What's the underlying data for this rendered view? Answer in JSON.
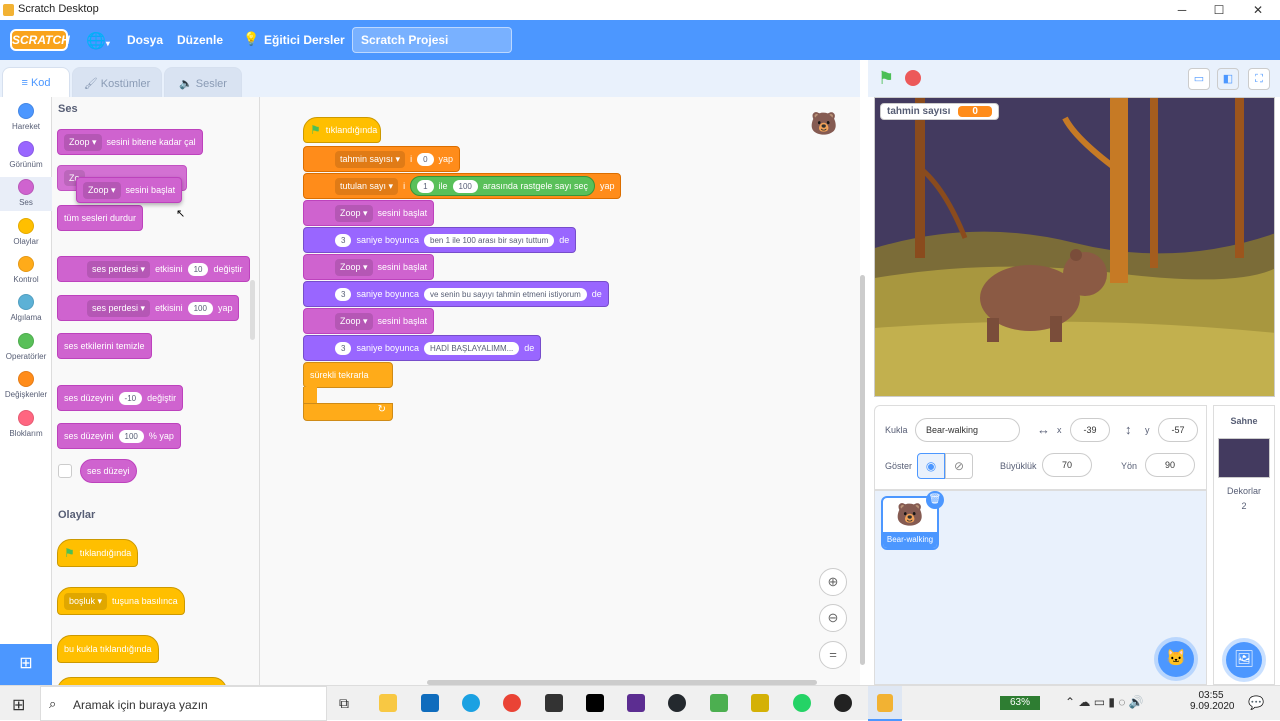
{
  "window": {
    "title": "Scratch Desktop",
    "controls": [
      "─",
      "☐",
      "✕"
    ]
  },
  "menubar": {
    "logo": "SCRATCH",
    "file": "Dosya",
    "edit": "Düzenle",
    "tutorials": "Eğitici Dersler",
    "project_title": "Scratch Projesi"
  },
  "tabs": {
    "code": "Kod",
    "costumes": "Kostümler",
    "sounds": "Sesler"
  },
  "categories": [
    {
      "label": "Hareket",
      "color": "#4c97ff"
    },
    {
      "label": "Görünüm",
      "color": "#9966ff"
    },
    {
      "label": "Ses",
      "color": "#cf63cf"
    },
    {
      "label": "Olaylar",
      "color": "#ffbf00"
    },
    {
      "label": "Kontrol",
      "color": "#ffab19"
    },
    {
      "label": "Algılama",
      "color": "#5cb1d6"
    },
    {
      "label": "Operatörler",
      "color": "#59c059"
    },
    {
      "label": "Değişkenler",
      "color": "#ff8c1a"
    },
    {
      "label": "Bloklarım",
      "color": "#ff6680"
    }
  ],
  "palette": {
    "sound_header": "Ses",
    "play_until_done": {
      "sound": "Zoop",
      "text": "sesini bitene kadar çal"
    },
    "start_sound_partial": "Zo",
    "start_sound_drag": {
      "sound": "Zoop",
      "text": "sesini başlat"
    },
    "stop_all": "tüm sesleri durdur",
    "change_effect": {
      "effect": "ses perdesi",
      "mid": "etkisini",
      "value": "10",
      "end": "değiştir"
    },
    "set_effect": {
      "effect": "ses perdesi",
      "mid": "etkisini",
      "value": "100",
      "end": "yap"
    },
    "clear_effects": "ses etkilerini temizle",
    "change_volume": {
      "pre": "ses düzeyini",
      "value": "-10",
      "end": "değiştir"
    },
    "set_volume": {
      "pre": "ses düzeyini",
      "value": "100",
      "end": "% yap"
    },
    "volume_reporter": "ses düzeyi",
    "events_header": "Olaylar",
    "when_flag": "tıklandığında",
    "when_key": {
      "key": "boşluk",
      "text": "tuşuna basılınca"
    },
    "when_sprite_clicked": "bu kukla tıklandığında"
  },
  "script": {
    "hat": "tıklandığında",
    "set_guess": {
      "var": "tahmin sayısı",
      "mid": "i",
      "value": "0",
      "end": "yap"
    },
    "set_target": {
      "var": "tutulan sayı",
      "mid": "i",
      "from": "1",
      "and": "ile",
      "to": "100",
      "text": "arasında rastgele sayı seç",
      "end": "yap"
    },
    "sound1": {
      "sound": "Zoop",
      "text": "sesini başlat"
    },
    "say1": {
      "secs": "3",
      "pre": "saniye boyunca",
      "msg": "ben 1 ile 100 arası bir sayı tuttum",
      "end": "de"
    },
    "sound2": {
      "sound": "Zoop",
      "text": "sesini başlat"
    },
    "say2": {
      "secs": "3",
      "pre": "saniye boyunca",
      "msg": "ve senin bu sayıyı tahmin etmeni istiyorum",
      "end": "de"
    },
    "sound3": {
      "sound": "Zoop",
      "text": "sesini başlat"
    },
    "say3": {
      "secs": "3",
      "pre": "saniye boyunca",
      "msg": "HADİ BAŞLAYALIMM...",
      "end": "de"
    },
    "forever": "sürekli tekrarla"
  },
  "stage": {
    "monitor_label": "tahmin sayısı",
    "monitor_value": "0"
  },
  "sprite_info": {
    "sprite_label": "Kukla",
    "sprite_name": "Bear-walking",
    "x_label": "x",
    "x_value": "-39",
    "y_label": "y",
    "y_value": "-57",
    "show_label": "Göster",
    "size_label": "Büyüklük",
    "size_value": "70",
    "direction_label": "Yön",
    "direction_value": "90"
  },
  "sprite_list": [
    {
      "name": "Bear-walking"
    }
  ],
  "stage_panel": {
    "title": "Sahne",
    "backdrops_label": "Dekorlar",
    "backdrops_count": "2"
  },
  "taskbar": {
    "search_placeholder": "Aramak için buraya yazın",
    "battery": "63%",
    "time": "03:55",
    "date": "9.09.2020"
  }
}
